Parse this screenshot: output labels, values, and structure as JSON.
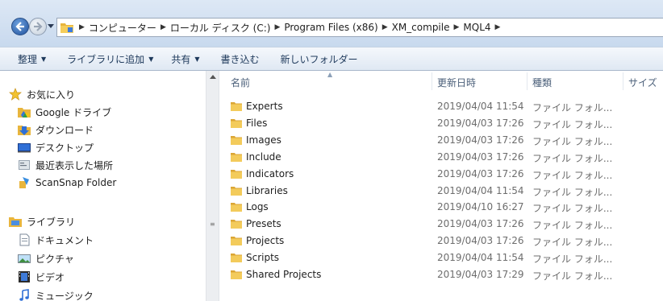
{
  "addressbar": {
    "breadcrumbs": [
      "コンピューター",
      "ローカル ディスク (C:)",
      "Program Files (x86)",
      "XM_compile",
      "MQL4"
    ]
  },
  "toolbar": {
    "organize": "整理",
    "add_to_library": "ライブラリに追加",
    "share": "共有",
    "burn": "書き込む",
    "new_folder": "新しいフォルダー"
  },
  "navpane": {
    "favorites": {
      "label": "お気に入り",
      "items": [
        {
          "label": "Google ドライブ",
          "icon": "google-drive-icon"
        },
        {
          "label": "ダウンロード",
          "icon": "downloads-icon"
        },
        {
          "label": "デスクトップ",
          "icon": "desktop-icon"
        },
        {
          "label": "最近表示した場所",
          "icon": "recent-places-icon"
        },
        {
          "label": "ScanSnap Folder",
          "icon": "scansnap-icon"
        }
      ]
    },
    "libraries": {
      "label": "ライブラリ",
      "items": [
        {
          "label": "ドキュメント",
          "icon": "documents-icon"
        },
        {
          "label": "ピクチャ",
          "icon": "pictures-icon"
        },
        {
          "label": "ビデオ",
          "icon": "videos-icon"
        },
        {
          "label": "ミュージック",
          "icon": "music-icon"
        }
      ]
    }
  },
  "columns": {
    "name": "名前",
    "date": "更新日時",
    "type": "種類",
    "size": "サイズ"
  },
  "files": [
    {
      "name": "Experts",
      "date": "2019/04/04 11:54",
      "type": "ファイル フォル..."
    },
    {
      "name": "Files",
      "date": "2019/04/03 17:26",
      "type": "ファイル フォル..."
    },
    {
      "name": "Images",
      "date": "2019/04/03 17:26",
      "type": "ファイル フォル..."
    },
    {
      "name": "Include",
      "date": "2019/04/03 17:26",
      "type": "ファイル フォル..."
    },
    {
      "name": "Indicators",
      "date": "2019/04/03 17:26",
      "type": "ファイル フォル..."
    },
    {
      "name": "Libraries",
      "date": "2019/04/04 11:54",
      "type": "ファイル フォル..."
    },
    {
      "name": "Logs",
      "date": "2019/04/10 16:27",
      "type": "ファイル フォル..."
    },
    {
      "name": "Presets",
      "date": "2019/04/03 17:26",
      "type": "ファイル フォル..."
    },
    {
      "name": "Projects",
      "date": "2019/04/03 17:26",
      "type": "ファイル フォル..."
    },
    {
      "name": "Scripts",
      "date": "2019/04/04 11:54",
      "type": "ファイル フォル..."
    },
    {
      "name": "Shared Projects",
      "date": "2019/04/03 17:29",
      "type": "ファイル フォル..."
    }
  ]
}
